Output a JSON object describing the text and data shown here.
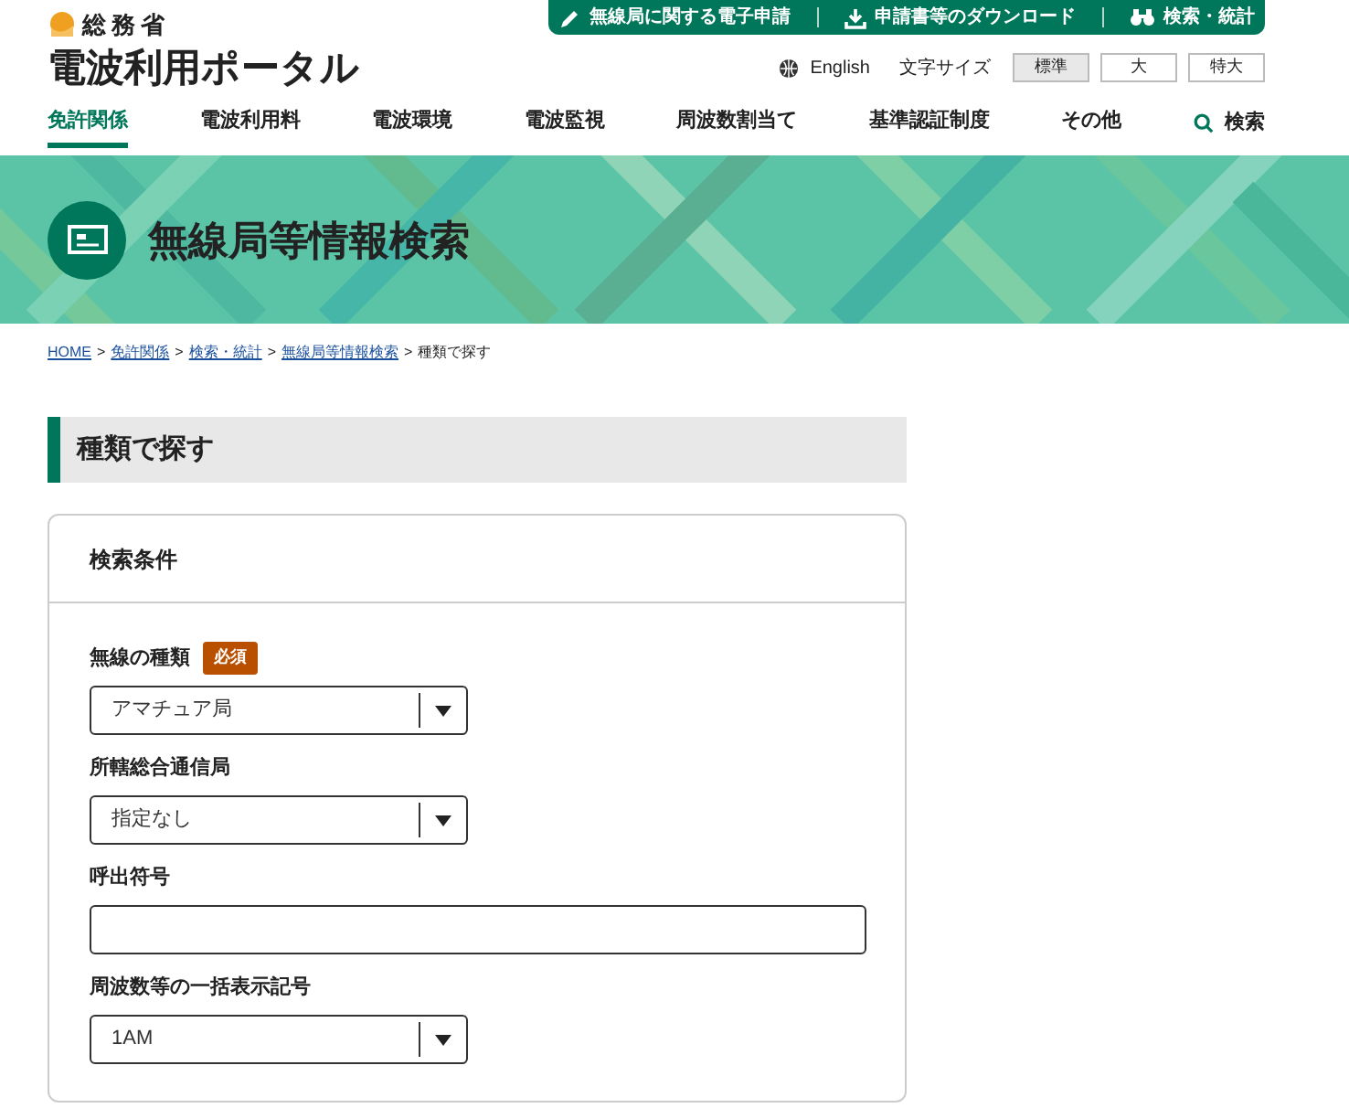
{
  "header": {
    "ministry": "総務省",
    "site_title": "電波利用ポータル",
    "top_links": [
      {
        "kind": "pen",
        "label": "無線局に関する電子申請"
      },
      {
        "kind": "download",
        "label": "申請書等のダウンロード"
      },
      {
        "kind": "binoculars",
        "label": "検索・統計"
      }
    ],
    "language_link": "English",
    "font_size_label": "文字サイズ",
    "font_sizes": [
      {
        "label": "標準",
        "selected": true
      },
      {
        "label": "大",
        "selected": false
      },
      {
        "label": "特大",
        "selected": false
      }
    ]
  },
  "nav": {
    "items": [
      {
        "label": "免許関係",
        "selected": true
      },
      {
        "label": "電波利用料",
        "selected": false
      },
      {
        "label": "電波環境",
        "selected": false
      },
      {
        "label": "電波監視",
        "selected": false
      },
      {
        "label": "周波数割当て",
        "selected": false
      },
      {
        "label": "基準認証制度",
        "selected": false
      },
      {
        "label": "その他",
        "selected": false
      }
    ],
    "search": "検索"
  },
  "banner": {
    "title": "無線局等情報検索"
  },
  "breadcrumb": [
    {
      "label": "HOME",
      "link": true
    },
    {
      "separator": ">",
      "label": "免許関係",
      "link": true
    },
    {
      "separator": ">",
      "label": "検索・統計",
      "link": true
    },
    {
      "separator": ">",
      "label": "無線局等情報検索",
      "link": true
    },
    {
      "separator": ">",
      "label": "種類で探す",
      "link": false
    }
  ],
  "section_title": "種類で探す",
  "form": {
    "title": "検索条件",
    "fields": [
      {
        "kind": "select",
        "label": "無線の種類",
        "badge": "必須",
        "value": "アマチュア局"
      },
      {
        "kind": "select",
        "label": "所轄総合通信局",
        "value": "指定なし"
      },
      {
        "kind": "text",
        "label": "呼出符号"
      },
      {
        "kind": "select",
        "label": "周波数等の一括表示記号",
        "value": "1AM"
      }
    ]
  }
}
